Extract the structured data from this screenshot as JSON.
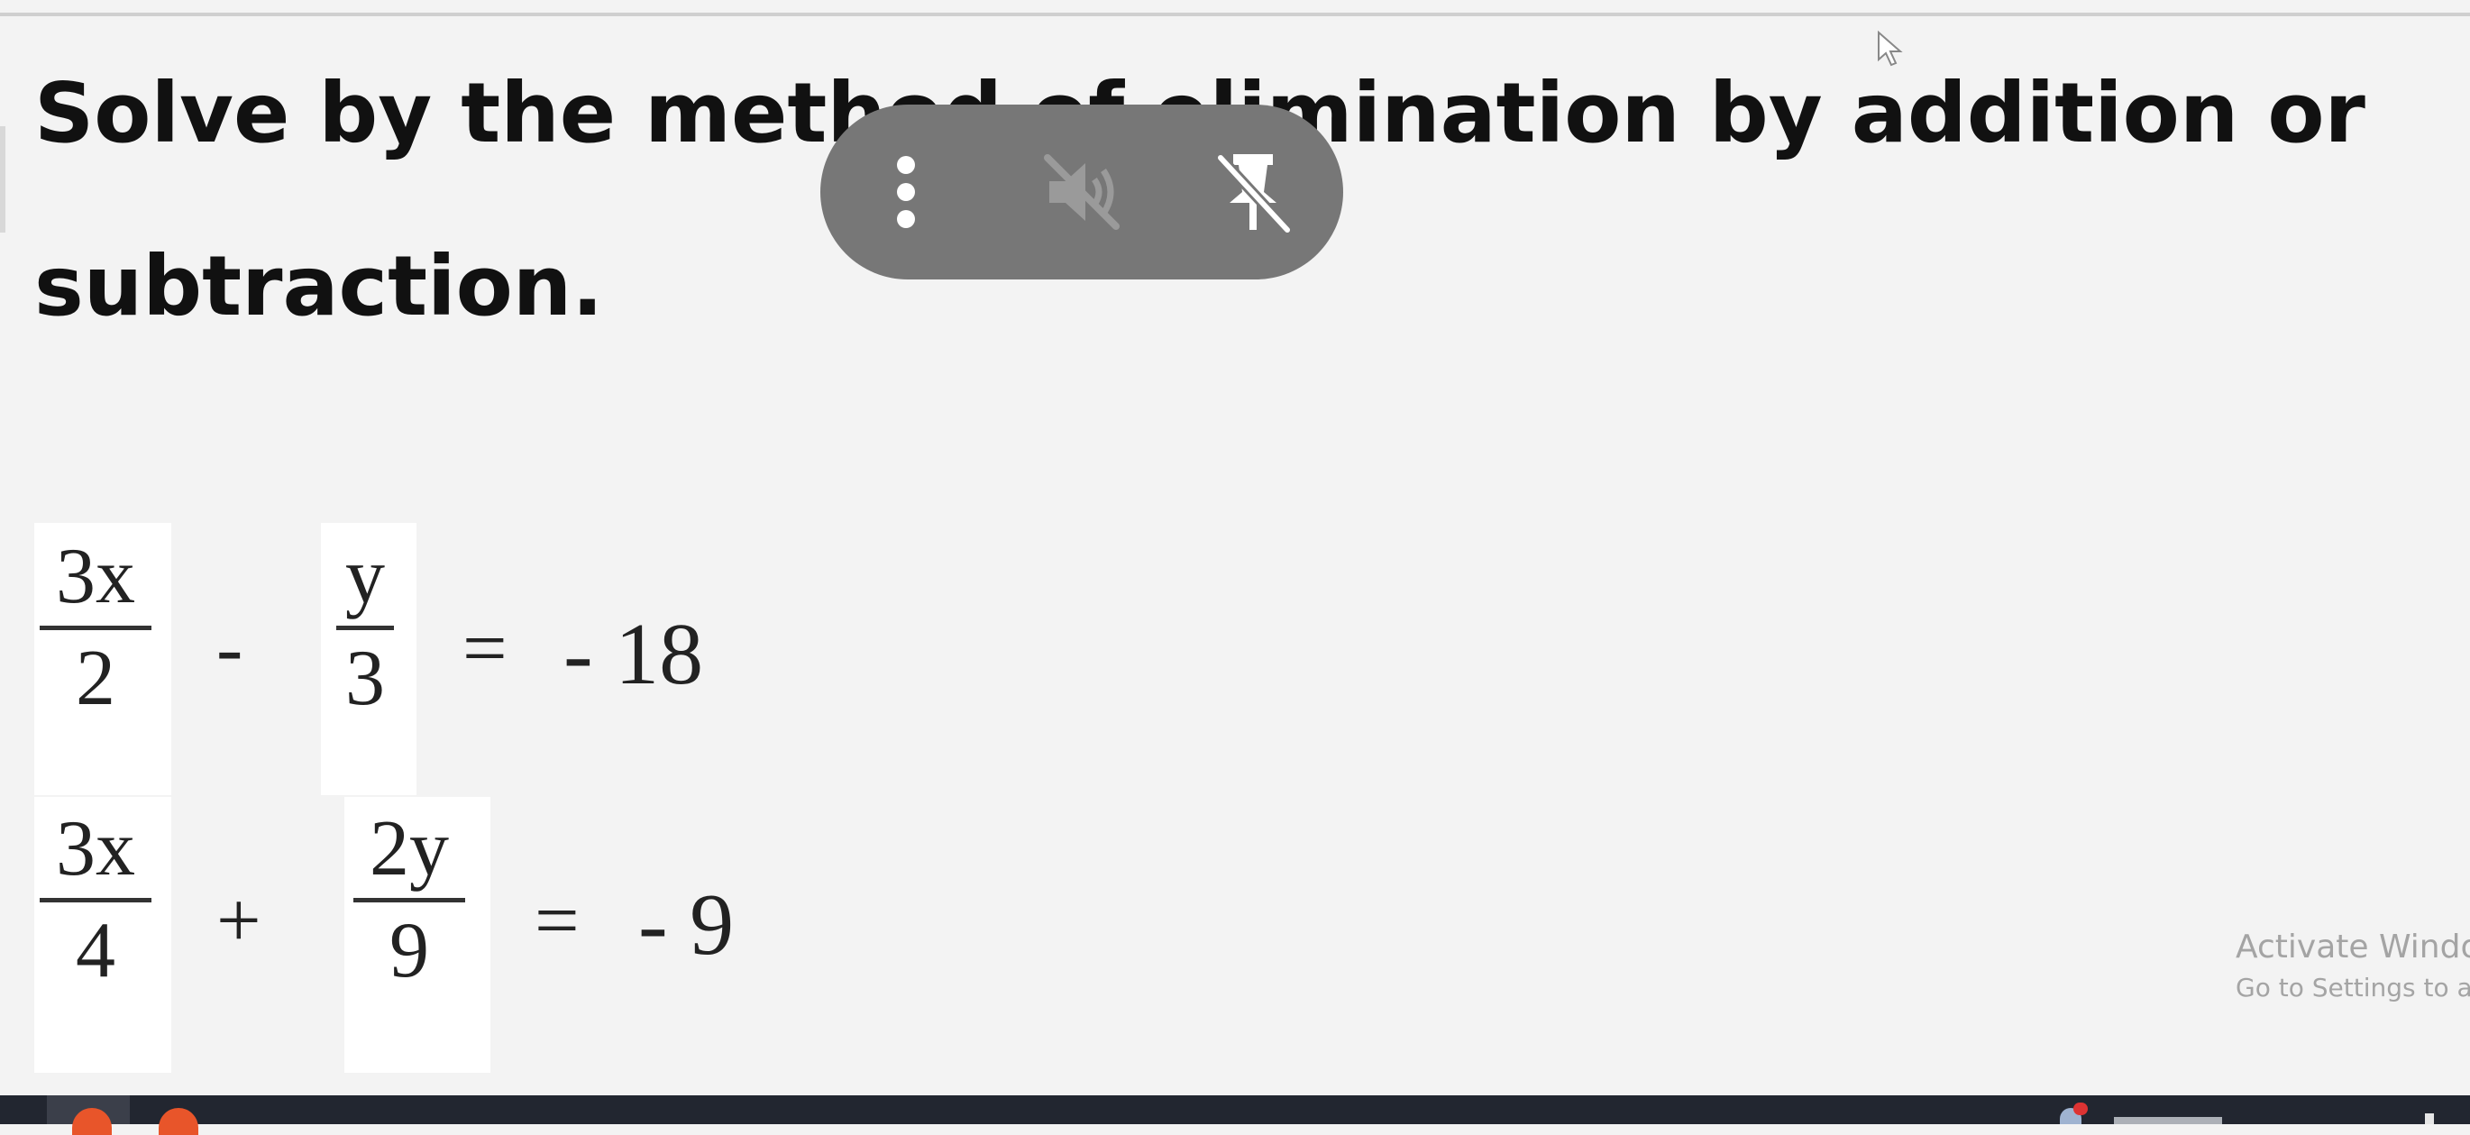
{
  "question": {
    "line1": "Solve by the method of elimination by addition or",
    "line2": "subtraction."
  },
  "equations": [
    {
      "term1": {
        "num": "3x",
        "den": "2"
      },
      "operator": "-",
      "term2": {
        "num": "y",
        "den": "3"
      },
      "equals": "=",
      "rhs": "- 18"
    },
    {
      "term1": {
        "num": "3x",
        "den": "4"
      },
      "operator": "+",
      "term2": {
        "num": "2y",
        "den": "9"
      },
      "equals": "=",
      "rhs": "- 9"
    }
  ],
  "floating_toolbar": {
    "icons": [
      "more-vertical-icon",
      "muted-speaker-icon",
      "unpin-icon"
    ]
  },
  "watermark": {
    "line1": "Activate Windo",
    "line2": "Go to Settings to ac"
  },
  "colors": {
    "background": "#f3f3f3",
    "toolbar": "#777777",
    "taskbar": "#222630",
    "watermark": "#a4a4a4"
  }
}
